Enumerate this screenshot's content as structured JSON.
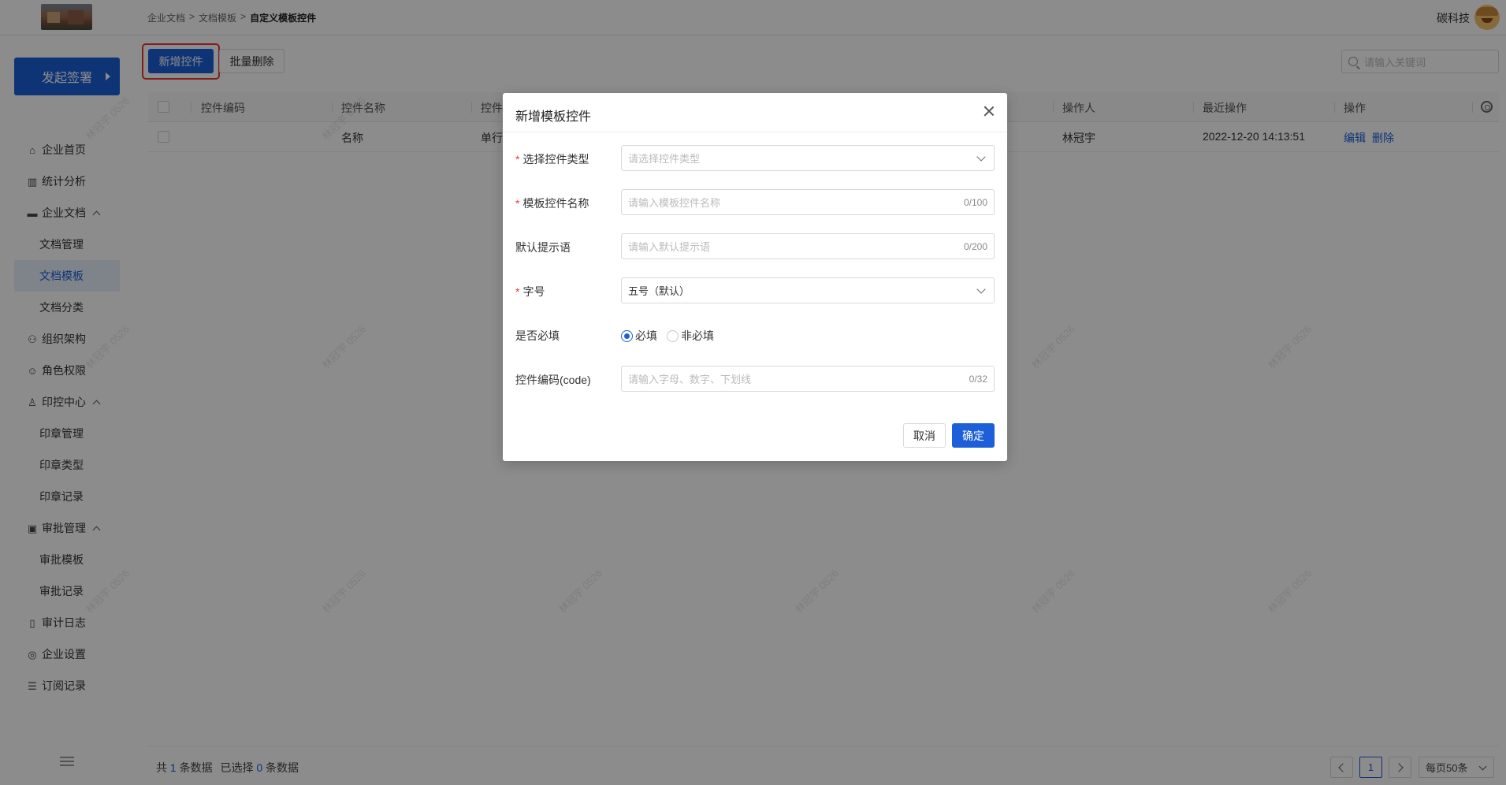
{
  "header": {
    "breadcrumb": [
      "企业文档",
      "文档模板",
      "自定义模板控件"
    ],
    "breadcrumb_sep": ">",
    "company": "碳科技"
  },
  "sidebar": {
    "start_label": "发起签署",
    "items": [
      {
        "label": "企业首页",
        "icon": "home-icon"
      },
      {
        "label": "统计分析",
        "icon": "bar-chart-icon"
      },
      {
        "label": "企业文档",
        "icon": "folder-icon",
        "expanded": true
      },
      {
        "label": "文档管理",
        "sub": true
      },
      {
        "label": "文档模板",
        "sub": true,
        "active": true
      },
      {
        "label": "文档分类",
        "sub": true
      },
      {
        "label": "组织架构",
        "icon": "org-chart-icon"
      },
      {
        "label": "角色权限",
        "icon": "user-role-icon"
      },
      {
        "label": "印控中心",
        "icon": "stamp-icon",
        "expanded": true
      },
      {
        "label": "印章管理",
        "sub": true
      },
      {
        "label": "印章类型",
        "sub": true
      },
      {
        "label": "印章记录",
        "sub": true
      },
      {
        "label": "审批管理",
        "icon": "clipboard-icon",
        "expanded": true
      },
      {
        "label": "审批模板",
        "sub": true
      },
      {
        "label": "审批记录",
        "sub": true
      },
      {
        "label": "审计日志",
        "icon": "book-icon"
      },
      {
        "label": "企业设置",
        "icon": "settings-icon"
      },
      {
        "label": "订阅记录",
        "icon": "list-icon"
      }
    ]
  },
  "toolbar": {
    "add_label": "新增控件",
    "batch_delete_label": "批量删除",
    "search_placeholder": "请输入关键词"
  },
  "table": {
    "columns": [
      "控件编码",
      "控件名称",
      "控件",
      "操作人",
      "最近操作",
      "操作"
    ],
    "rows": [
      {
        "code": "",
        "name": "名称",
        "type": "单行",
        "operator": "林冠宇",
        "last_op": "2022-12-20 14:13:51",
        "actions": [
          "编辑",
          "删除"
        ]
      }
    ]
  },
  "footer": {
    "total_prefix": "共",
    "total": "1",
    "total_suffix": "条数据",
    "selected_prefix": "已选择",
    "selected": "0",
    "selected_suffix": "条数据",
    "current_page": "1",
    "page_size": "每页50条"
  },
  "watermark": "林冠宇 0526",
  "modal": {
    "title": "新增模板控件",
    "fields": {
      "type": {
        "label": "选择控件类型",
        "required": true,
        "placeholder": "请选择控件类型"
      },
      "name": {
        "label": "模板控件名称",
        "required": true,
        "placeholder": "请输入模板控件名称",
        "counter": "0/100"
      },
      "hint": {
        "label": "默认提示语",
        "required": false,
        "placeholder": "请输入默认提示语",
        "counter": "0/200"
      },
      "font_size": {
        "label": "字号",
        "required": true,
        "value": "五号（默认）"
      },
      "mandatory": {
        "label": "是否必填",
        "options": [
          "必填",
          "非必填"
        ],
        "selected": "必填"
      },
      "code": {
        "label": "控件编码(code)",
        "required": false,
        "placeholder": "请输入字母、数字、下划线",
        "counter": "0/32"
      }
    },
    "cancel_label": "取消",
    "ok_label": "确定"
  },
  "colors": {
    "primary": "#1d5fd8",
    "danger": "#e53935",
    "overlay": "rgba(0,0,0,0.45)"
  }
}
